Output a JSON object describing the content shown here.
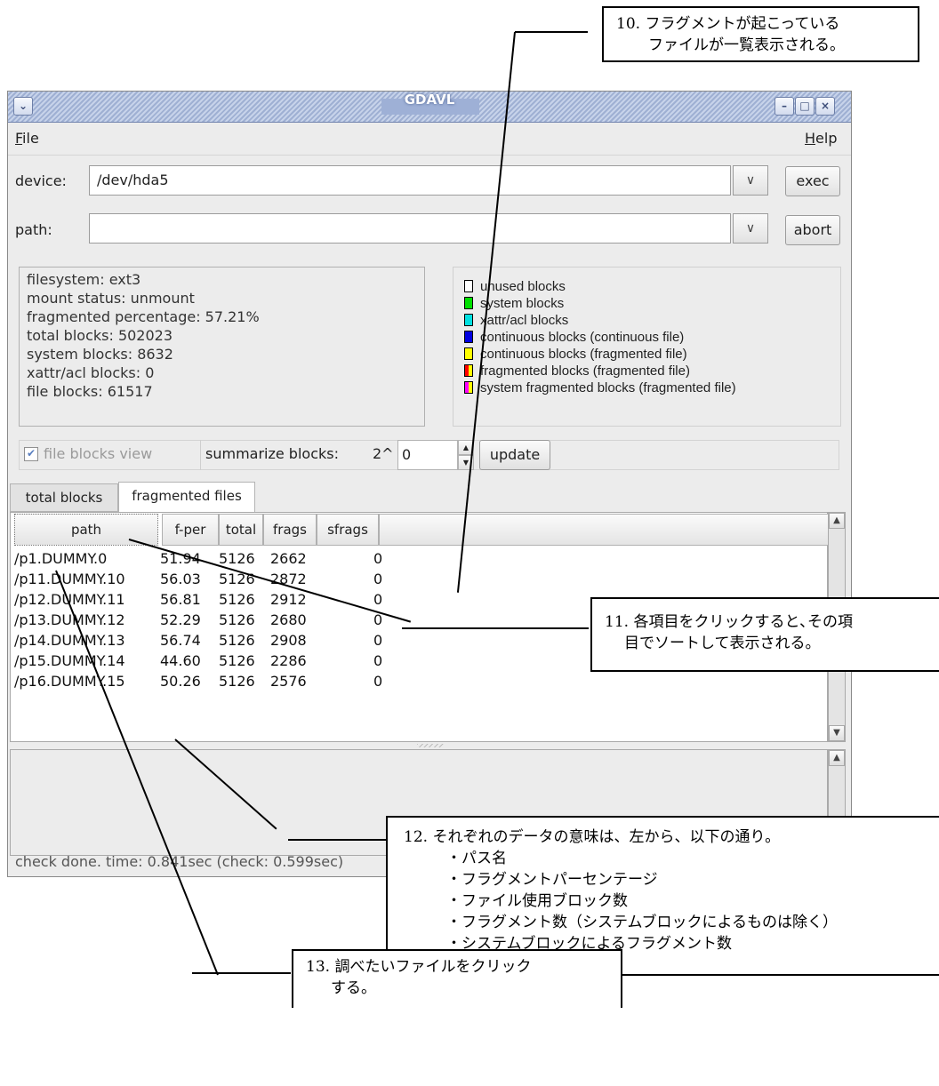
{
  "window": {
    "title": "GDAVL",
    "menu": {
      "file": "File",
      "help": "Help"
    },
    "device_label": "device:",
    "device_value": "/dev/hda5",
    "path_label": "path:",
    "path_value": "",
    "exec_label": "exec",
    "abort_label": "abort",
    "info_lines": [
      "filesystem: ext3",
      "mount status: unmount",
      "fragmented percentage: 57.21%",
      "total blocks: 502023",
      "system blocks: 8632",
      "xattr/acl blocks: 0",
      "file blocks: 61517"
    ],
    "legend": [
      {
        "label": "unused blocks",
        "color": "#ffffff"
      },
      {
        "label": "system blocks",
        "color": "#00e000"
      },
      {
        "label": "xattr/acl blocks",
        "color": "#00e0e0"
      },
      {
        "label": "continuous blocks (continuous file)",
        "color": "#0000e0"
      },
      {
        "label": "continuous blocks (fragmented file)",
        "color": "#ffff00"
      },
      {
        "label": "fragmented blocks (fragmented file)",
        "color": "split-red-yellow"
      },
      {
        "label": "system fragmented blocks (fragmented file)",
        "color": "split-magenta-yellow"
      }
    ],
    "file_blocks_view_label": "file blocks view",
    "file_blocks_view_checked": true,
    "summarize_label": "summarize blocks:",
    "summarize_prefix": "2^",
    "summarize_value": "0",
    "update_label": "update",
    "tabs": {
      "total": "total blocks",
      "fragmented": "fragmented files",
      "active": "fragmented"
    },
    "columns": [
      "path",
      "f-per",
      "total",
      "frags",
      "sfrags"
    ],
    "rows": [
      [
        "/p1.DUMMY.0",
        "51.94",
        "5126",
        "2662",
        "0"
      ],
      [
        "/p11.DUMMY.10",
        "56.03",
        "5126",
        "2872",
        "0"
      ],
      [
        "/p12.DUMMY.11",
        "56.81",
        "5126",
        "2912",
        "0"
      ],
      [
        "/p13.DUMMY.12",
        "52.29",
        "5126",
        "2680",
        "0"
      ],
      [
        "/p14.DUMMY.13",
        "56.74",
        "5126",
        "2908",
        "0"
      ],
      [
        "/p15.DUMMY.14",
        "44.60",
        "5126",
        "2286",
        "0"
      ],
      [
        "/p16.DUMMY.15",
        "50.26",
        "5126",
        "2576",
        "0"
      ]
    ],
    "status": "check done.     time: 0.841sec (check: 0.599sec)"
  },
  "callouts": {
    "c10": [
      "10. フラグメントが起こっている",
      "ファイルが一覧表示される。"
    ],
    "c11": [
      "11. 各項目をクリックすると､その項",
      "目でソートして表示される。"
    ],
    "c12": [
      "12. それぞれのデータの意味は、左から、以下の通り。",
      "・パス名",
      "・フラグメントパーセンテージ",
      "・ファイル使用ブロック数",
      "・フラグメント数（システムブロックによるものは除く）",
      "・システムブロックによるフラグメント数"
    ],
    "c13": [
      "13. 調べたいファイルをクリック",
      "する。"
    ]
  }
}
